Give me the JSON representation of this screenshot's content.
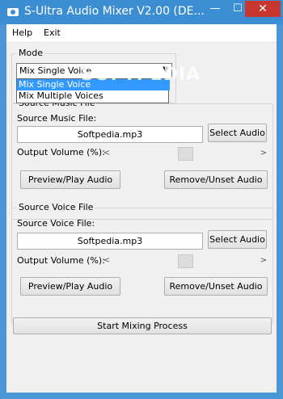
{
  "window": {
    "title": "S-Ultra Audio Mixer V2.00 (DE...",
    "minimize_glyph": "—",
    "maximize_glyph": "☐",
    "close_glyph": "✕"
  },
  "menu": {
    "help": "Help",
    "exit": "Exit"
  },
  "mode": {
    "group_title": "Mode",
    "selected": "Mix Single Voice",
    "options": [
      "Mix Single Voice",
      "Mix Multiple Voices"
    ]
  },
  "watermark": "SOFTPEDIA",
  "music": {
    "group_title": "Source Music File",
    "field_label": "Source Music File:",
    "file_value": "Softpedia.mp3",
    "select_button": "Select Audio",
    "volume_label": "Output Volume (%):",
    "volume_level_percent": 50,
    "preview_button": "Preview/Play Audio",
    "remove_button": "Remove/Unset Audio"
  },
  "voice": {
    "group_title": "Source Voice File",
    "field_label": "Source Voice File:",
    "file_value": "Softpedia.mp3",
    "select_button": "Select Audio",
    "volume_label": "Output Volume (%):",
    "volume_level_percent": 50,
    "preview_button": "Preview/Play Audio",
    "remove_button": "Remove/Unset Audio"
  },
  "start_button": "Start Mixing Process",
  "colors": {
    "titlebar": "#3c8ed3",
    "close": "#c7372f",
    "selection": "#3399ff"
  },
  "icons": {
    "app": "speaker-icon",
    "left": "arrow-left-icon",
    "right": "arrow-right-icon"
  }
}
